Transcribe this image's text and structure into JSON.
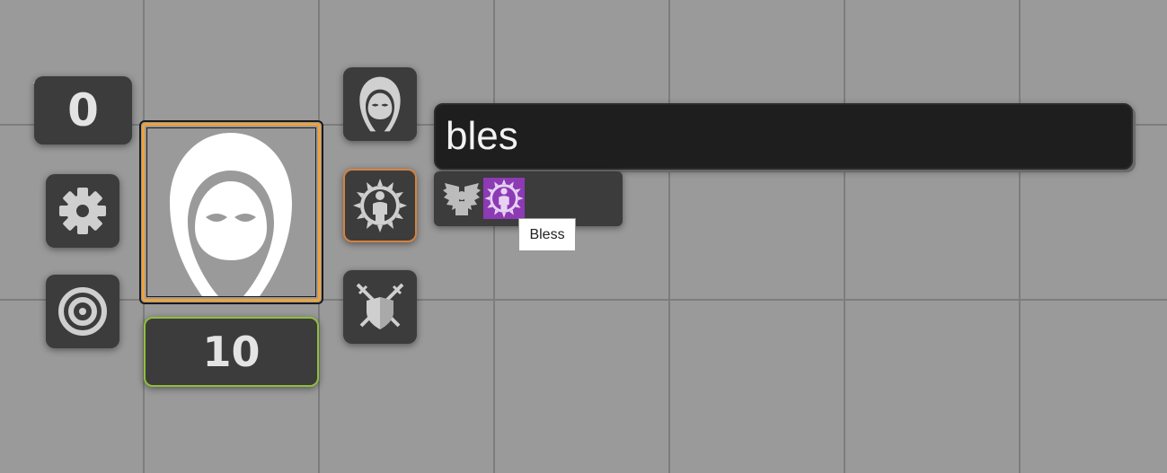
{
  "token": {
    "elevation": "0",
    "hit_points": "10",
    "portrait_icon": "hooded-figure-icon"
  },
  "left_controls": [
    {
      "name": "settings",
      "icon": "gear-icon"
    },
    {
      "name": "target",
      "icon": "target-icon"
    }
  ],
  "right_controls": [
    {
      "name": "character",
      "icon": "hooded-figure-icon"
    },
    {
      "name": "effects",
      "icon": "radiant-figure-icon",
      "active": true
    },
    {
      "name": "combat",
      "icon": "crossed-swords-shield-icon"
    }
  ],
  "search": {
    "value": "bles"
  },
  "results": [
    {
      "icon": "winged-figure-icon",
      "color": "#bcbcbc"
    },
    {
      "icon": "radiant-figure-icon",
      "color": "#8d3ab5",
      "label": "Bless"
    }
  ],
  "tooltip": {
    "text": "Bless"
  },
  "colors": {
    "portrait_border": "#f0a23a",
    "hp_border": "#8fbf3c",
    "active_border": "#d5823f",
    "bless_bg": "#8d3ab5",
    "tile_bg": "#3c3c3c"
  }
}
